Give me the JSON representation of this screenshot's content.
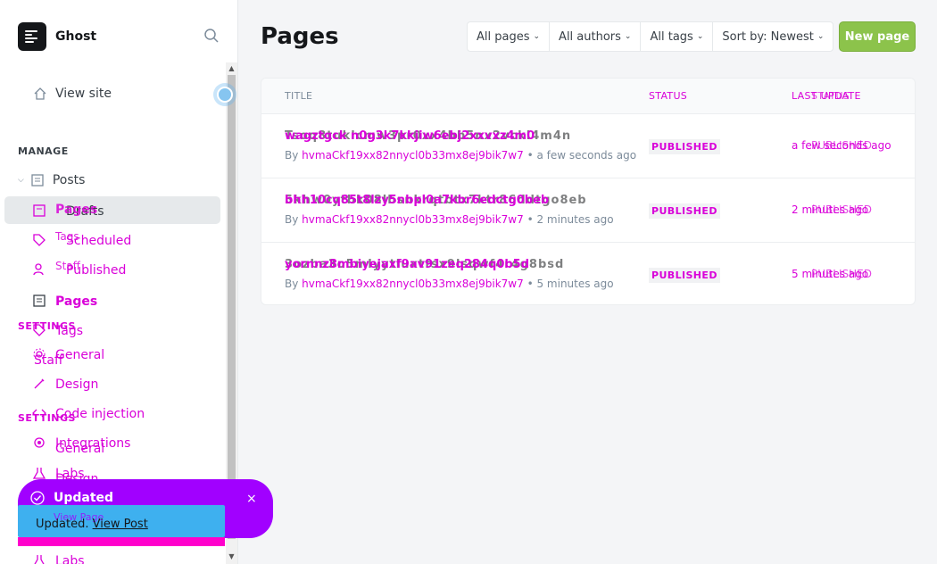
{
  "brand": {
    "name": "Ghost"
  },
  "sidebar": {
    "view_site": "View site",
    "manage_label": "MANAGE",
    "posts": "Posts",
    "posts_sub": [
      {
        "ghost": "Pages",
        "label": "Drafts"
      },
      {
        "ghost": "Tags",
        "label": "Scheduled"
      },
      {
        "ghost": "Staff",
        "label": "Published"
      }
    ],
    "pages": "Pages",
    "tags": "Tags",
    "staff": "Staff",
    "settings_label": "SETTINGS",
    "settings_items": [
      "General",
      "Design",
      "Code injection",
      "Integrations",
      "Labs"
    ],
    "ghost_settings_items": [
      "General",
      "Design"
    ]
  },
  "main": {
    "title": "Pages",
    "filters": [
      "All pages",
      "All authors",
      "All tags",
      "Sort by: Newest"
    ],
    "new_button": "New page",
    "columns": {
      "title": "TITLE",
      "status": "STATUS",
      "last_update": "LAST UPDATE",
      "last_update_ghost": "STATUS"
    },
    "rows": [
      {
        "title": "wagztgck  n0g3k7kkjiw6ebj2xxvxz4m0",
        "title_ghost": "Tsoq8tuklcmw3pr0xx4bb5nx2vckl4m4n",
        "by": "By",
        "author": "hvmaCkf19xx82nnycl0b33mx8ej9bik7w7",
        "time": "• a few seconds ago",
        "status": "PUBLISHED",
        "updated": "a few seconds ago",
        "updated_ghost": "PUBLISHED"
      },
      {
        "title": "bhh10cq85t8lzy5nbpl0a7kbr6edctg0beb",
        "title_ghost": "5khw0ytbk08lbsnkrqtbtx7ktr86ddtgo8eb",
        "by": "By",
        "author": "hvmaCkf19xx82nnycl0b33mx8ej9bik7w7",
        "time": "• 2 minutes ago",
        "status": "PUBLISHED",
        "updated": "2 minutes ago",
        "updated_ghost": "PUBLISHED"
      },
      {
        "title": "yornnz8mbiyejaxf9av91zeq284q0b5d",
        "title_ghost": "3ozba3o5mlyytluxtfsx9lsqwf4r4g8bsd",
        "by": "By",
        "author": "hvmaCkf19xx82nnycl0b33mx8ej9bik7w7",
        "time": "• 5 minutes ago",
        "status": "PUBLISHED",
        "updated": "5 minutes ago",
        "updated_ghost": "PUBLISHED"
      }
    ]
  },
  "toast": {
    "title": "Updated",
    "secondary_prefix": "Updated.",
    "secondary_link": "View Post",
    "ghost_link": "View Page",
    "close": "×"
  },
  "colors": {
    "accent_green": "#8cc34b",
    "overlay_magenta": "#d900d9",
    "toast_purple": "#a100ff",
    "toast_blue": "#3eb0ef"
  },
  "icons": {
    "search": "search-icon",
    "home": "home-icon",
    "posts": "posts-icon",
    "pages": "pages-icon",
    "tags": "tag-icon",
    "staff": "staff-icon",
    "general": "gear-icon",
    "design": "brush-icon",
    "integrations": "integrations-icon",
    "labs": "flask-icon",
    "check": "check-icon",
    "close": "close-icon"
  }
}
